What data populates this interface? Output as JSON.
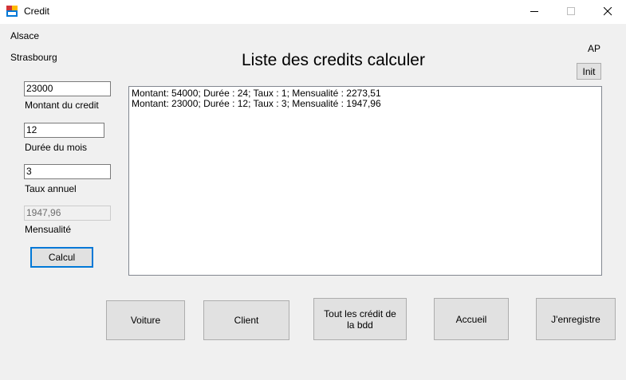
{
  "window": {
    "title": "Credit"
  },
  "top_labels": {
    "region": "Alsace",
    "city": "Strasbourg",
    "user": "AP"
  },
  "heading": "Liste des credits calculer",
  "form": {
    "amount": {
      "value": "23000",
      "label": "Montant du credit"
    },
    "duration": {
      "value": "12",
      "label": "Durée du mois"
    },
    "rate": {
      "value": "3",
      "label": "Taux annuel"
    },
    "monthly": {
      "value": "1947,96",
      "label": "Mensualité"
    },
    "calc_label": "Calcul"
  },
  "init_label": "Init",
  "list": {
    "rows": [
      "Montant: 54000; Durée : 24; Taux : 1; Mensualité : 2273,51",
      "Montant: 23000; Durée : 12; Taux : 3; Mensualité : 1947,96"
    ]
  },
  "buttons": {
    "voiture": "Voiture",
    "client": "Client",
    "all_credits": "Tout les crédit de la bdd",
    "accueil": "Accueil",
    "save": "J'enregistre"
  }
}
